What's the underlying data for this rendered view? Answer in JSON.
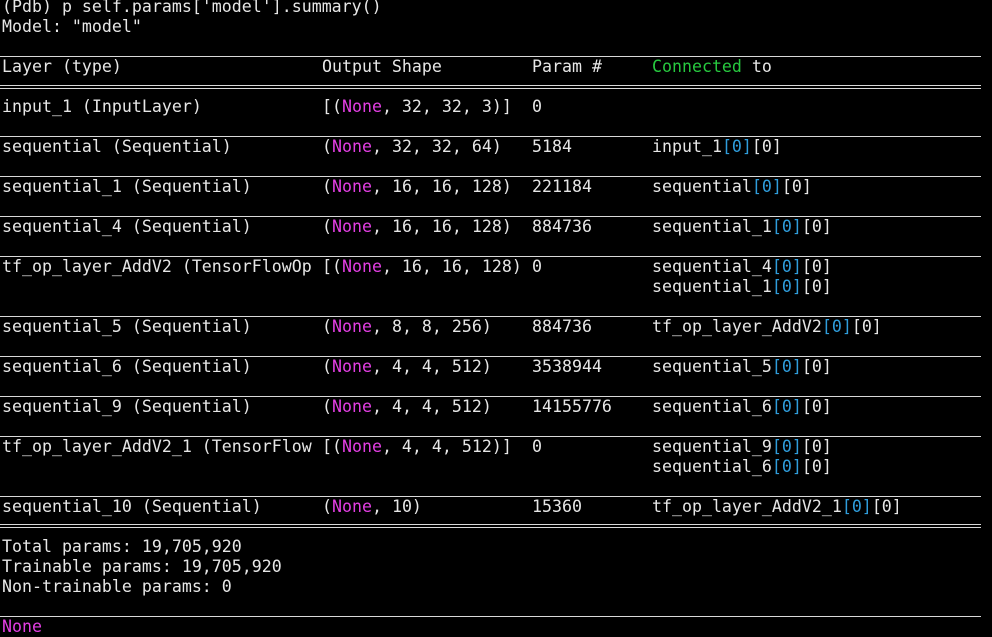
{
  "prompt_line": "(Pdb) p self.params['model'].summary()",
  "model_line": "Model: \"model\"",
  "header": {
    "layer": "Layer (type)",
    "shape": "Output Shape",
    "param": "Param #",
    "connected": "Connected",
    "to": "to"
  },
  "none_word": "None",
  "rows": [
    {
      "layer": "input_1 (InputLayer)",
      "shape_open": "[(",
      "shape_rest": ", 32, 32, 3)]",
      "param": "0",
      "connections": []
    },
    {
      "layer": "sequential (Sequential)",
      "shape_open": "(",
      "shape_rest": ", 32, 32, 64)",
      "param": "5184",
      "connections": [
        {
          "name": "input_1",
          "idx": "[0]",
          "tail": "[0]"
        }
      ]
    },
    {
      "layer": "sequential_1 (Sequential)",
      "shape_open": "(",
      "shape_rest": ", 16, 16, 128)",
      "param": "221184",
      "connections": [
        {
          "name": "sequential",
          "idx": "[0]",
          "tail": "[0]"
        }
      ]
    },
    {
      "layer": "sequential_4 (Sequential)",
      "shape_open": "(",
      "shape_rest": ", 16, 16, 128)",
      "param": "884736",
      "connections": [
        {
          "name": "sequential_1",
          "idx": "[0]",
          "tail": "[0]"
        }
      ]
    },
    {
      "layer": "tf_op_layer_AddV2 (TensorFlowOp",
      "shape_open": "[(",
      "shape_rest": ", 16, 16, 128)",
      "param": "0",
      "connections": [
        {
          "name": "sequential_4",
          "idx": "[0]",
          "tail": "[0]"
        },
        {
          "name": "sequential_1",
          "idx": "[0]",
          "tail": "[0]"
        }
      ]
    },
    {
      "layer": "sequential_5 (Sequential)",
      "shape_open": "(",
      "shape_rest": ", 8, 8, 256)",
      "param": "884736",
      "connections": [
        {
          "name": "tf_op_layer_AddV2",
          "idx": "[0]",
          "tail": "[0]"
        }
      ]
    },
    {
      "layer": "sequential_6 (Sequential)",
      "shape_open": "(",
      "shape_rest": ", 4, 4, 512)",
      "param": "3538944",
      "connections": [
        {
          "name": "sequential_5",
          "idx": "[0]",
          "tail": "[0]"
        }
      ]
    },
    {
      "layer": "sequential_9 (Sequential)",
      "shape_open": "(",
      "shape_rest": ", 4, 4, 512)",
      "param": "14155776",
      "connections": [
        {
          "name": "sequential_6",
          "idx": "[0]",
          "tail": "[0]"
        }
      ]
    },
    {
      "layer": "tf_op_layer_AddV2_1 (TensorFlow",
      "shape_open": "[(",
      "shape_rest": ", 4, 4, 512)]",
      "param": "0",
      "connections": [
        {
          "name": "sequential_9",
          "idx": "[0]",
          "tail": "[0]"
        },
        {
          "name": "sequential_6",
          "idx": "[0]",
          "tail": "[0]"
        }
      ]
    },
    {
      "layer": "sequential_10 (Sequential)",
      "shape_open": "(",
      "shape_rest": ", 10)",
      "param": "15360",
      "connections": [
        {
          "name": "tf_op_layer_AddV2_1",
          "idx": "[0]",
          "tail": "[0]"
        }
      ]
    }
  ],
  "totals": {
    "total": "Total params: 19,705,920",
    "trainable": "Trainable params: 19,705,920",
    "non_trainable": "Non-trainable params: 0"
  },
  "return_value": "None",
  "colors": {
    "none_keyword": "#e23ee2",
    "index": "#2f9ddb",
    "connected": "#27c93f"
  }
}
